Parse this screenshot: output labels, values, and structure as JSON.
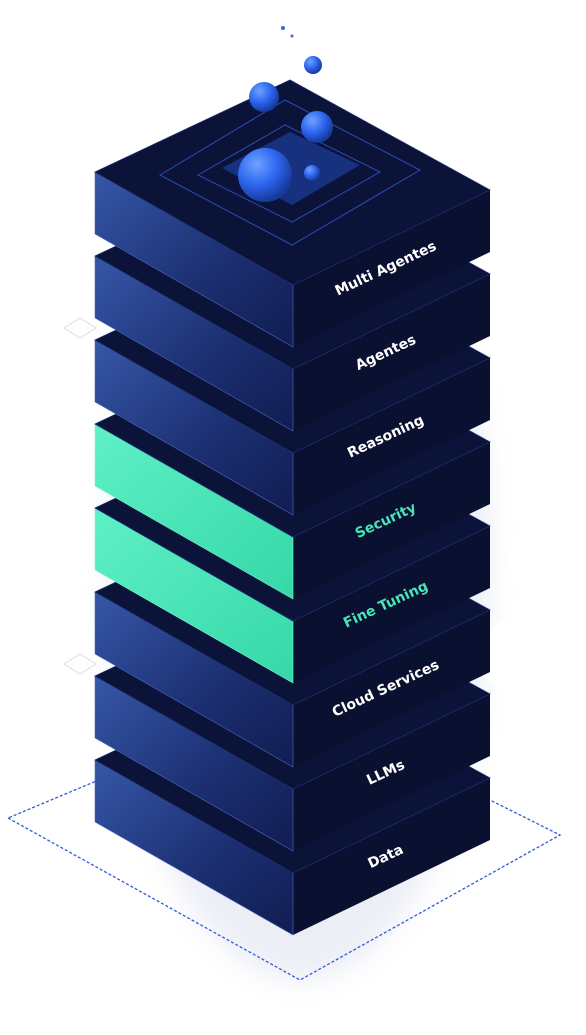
{
  "layers": [
    {
      "label": "Data",
      "highlight": false
    },
    {
      "label": "LLMs",
      "highlight": false
    },
    {
      "label": "Cloud Services",
      "highlight": false
    },
    {
      "label": "Fine Tuning",
      "highlight": true
    },
    {
      "label": "Security",
      "highlight": true
    },
    {
      "label": "Reasoning",
      "highlight": false
    },
    {
      "label": "Agentes",
      "highlight": false
    },
    {
      "label": "Multi Agentes",
      "highlight": false
    }
  ],
  "colors": {
    "top": "#0c1338",
    "right_face": "#0a1030",
    "left_face": "#1a2f72",
    "highlight_face": "#47e6bb",
    "highlight_text": "#49e3b6",
    "label_text": "#ffffff",
    "sphere": "#2d66f0",
    "outline": "#2f5bd9"
  }
}
